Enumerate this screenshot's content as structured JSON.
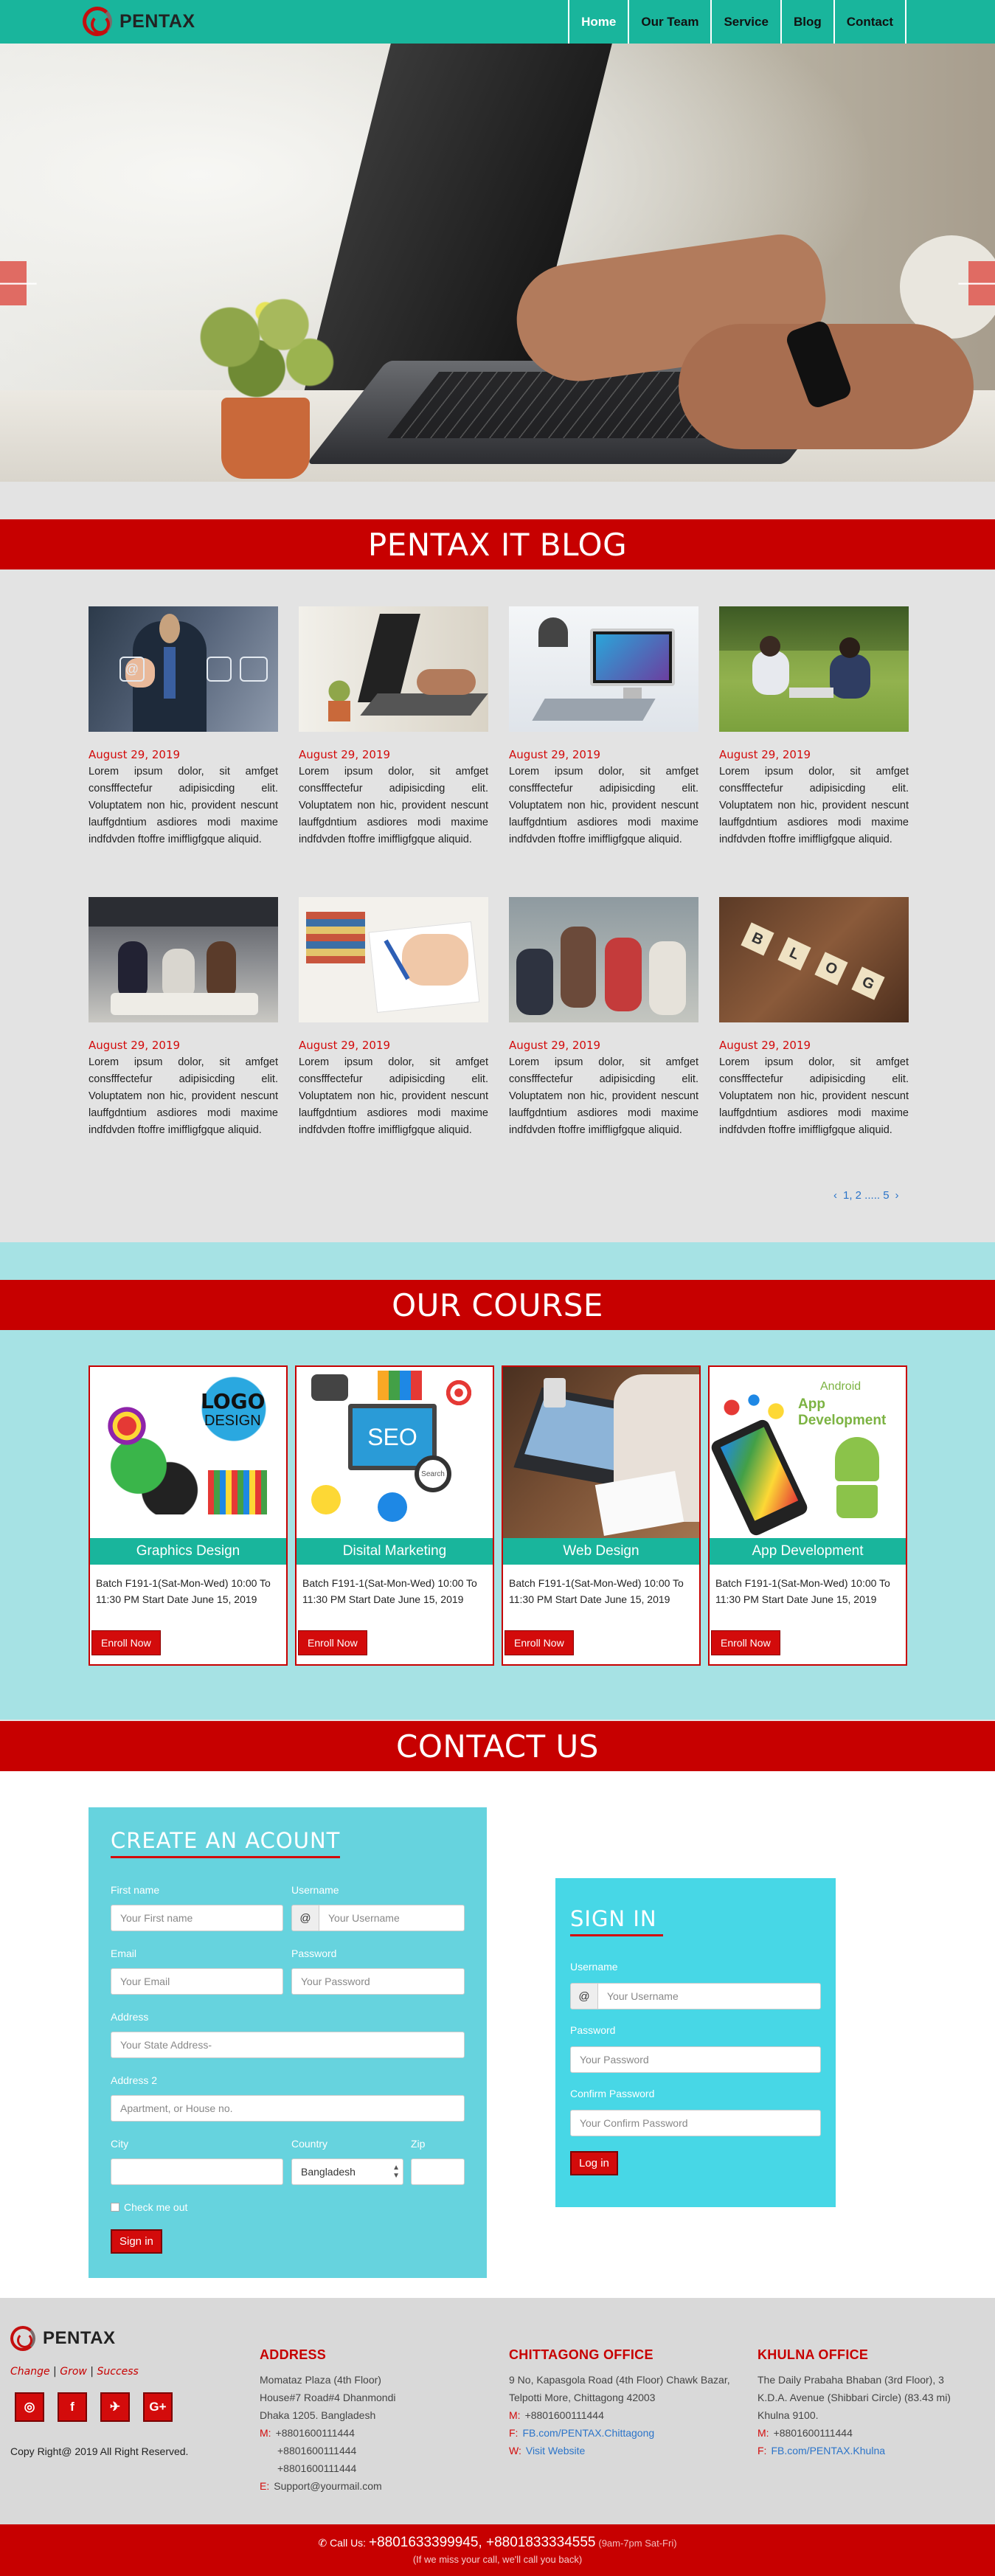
{
  "brand": {
    "name": "PENTAX"
  },
  "nav": {
    "items": [
      "Home",
      "Our Team",
      "Service",
      "Blog",
      "Contact"
    ]
  },
  "hero": {
    "prev_icon": "arrow-left-icon",
    "next_icon": "arrow-right-icon",
    "left_arrow": "🡐",
    "right_arrow": "🡒",
    "slides": 6,
    "active_slide": 2
  },
  "blog": {
    "heading": "PENTAX IT BLOG",
    "posts": [
      {
        "date": "August 29, 2019",
        "text": "Lorem ipsum dolor, sit amfget consfffectefur adipisicding elit. Voluptatem non hic, provident nescunt lauffgdntium asdiores modi maxime indfdvden ftoffre imiffligfgque aliquid."
      },
      {
        "date": "August 29, 2019",
        "text": "Lorem ipsum dolor, sit amfget consfffectefur adipisicding elit. Voluptatem non hic, provident nescunt lauffgdntium asdiores modi maxime indfdvden ftoffre imiffligfgque aliquid."
      },
      {
        "date": "August 29, 2019",
        "text": "Lorem ipsum dolor, sit amfget consfffectefur adipisicding elit. Voluptatem non hic, provident nescunt lauffgdntium asdiores modi maxime indfdvden ftoffre imiffligfgque aliquid."
      },
      {
        "date": "August 29, 2019",
        "text": "Lorem ipsum dolor, sit amfget consfffectefur adipisicding elit. Voluptatem non hic, provident nescunt lauffgdntium asdiores modi maxime indfdvden ftoffre imiffligfgque aliquid."
      },
      {
        "date": "August 29, 2019",
        "text": "Lorem ipsum dolor, sit amfget consfffectefur adipisicding elit. Voluptatem non hic, provident nescunt lauffgdntium asdiores modi maxime indfdvden ftoffre imiffligfgque aliquid."
      },
      {
        "date": "August 29, 2019",
        "text": "Lorem ipsum dolor, sit amfget consfffectefur adipisicding elit. Voluptatem non hic, provident nescunt lauffgdntium asdiores modi maxime indfdvden ftoffre imiffligfgque aliquid."
      },
      {
        "date": "August 29, 2019",
        "text": "Lorem ipsum dolor, sit amfget consfffectefur adipisicding elit. Voluptatem non hic, provident nescunt lauffgdntium asdiores modi maxime indfdvden ftoffre imiffligfgque aliquid."
      },
      {
        "date": "August 29, 2019",
        "text": "Lorem ipsum dolor, sit amfget consfffectefur adipisicding elit. Voluptatem non hic, provident nescunt lauffgdntium asdiores modi maxime indfdvden ftoffre imiffligfgque aliquid."
      }
    ],
    "pager": {
      "prev": "‹",
      "pages": "1, 2 ..... 5",
      "next": "›"
    }
  },
  "courses": {
    "heading": "OUR COURSE",
    "items": [
      {
        "title": "Graphics Design",
        "desc": "Batch F191-1(Sat-Mon-Wed) 10:00 To 11:30 PM Start Date June 15, 2019",
        "button": "Enroll Now",
        "img_text_1": "LOGO",
        "img_text_2": "DESIGN"
      },
      {
        "title": "Disital Marketing",
        "desc": "Batch F191-1(Sat-Mon-Wed) 10:00 To 11:30 PM Start Date June 15, 2019",
        "button": "Enroll Now",
        "img_text_1": "SEO",
        "img_text_2": "Search"
      },
      {
        "title": "Web Design",
        "desc": "Batch F191-1(Sat-Mon-Wed) 10:00 To 11:30 PM Start Date June 15, 2019",
        "button": "Enroll Now"
      },
      {
        "title": "App Development",
        "desc": "Batch F191-1(Sat-Mon-Wed) 10:00 To 11:30 PM Start Date June 15, 2019",
        "button": "Enroll Now",
        "img_text_1": "Android",
        "img_text_2": "App Development"
      }
    ]
  },
  "contact": {
    "heading": "CONTACT US",
    "create": {
      "title": "CREATE AN ACOUNT",
      "first_name_label": "First name",
      "first_name_ph": "Your First name",
      "username_label": "Username",
      "username_ph": "Your Username",
      "at": "@",
      "email_label": "Email",
      "email_ph": "Your Email",
      "password_label": "Password",
      "password_ph": "Your Password",
      "address_label": "Address",
      "address_ph": "Your State Address-",
      "address2_label": "Address 2",
      "address2_ph": "Apartment, or House no.",
      "city_label": "City",
      "country_label": "Country",
      "country_value": "Bangladesh",
      "zip_label": "Zip",
      "check_label": "Check me out",
      "submit": "Sign in"
    },
    "signin": {
      "title": "SIGN IN",
      "username_label": "Username",
      "username_ph": "Your Username",
      "at": "@",
      "password_label": "Password",
      "password_ph": "Your Password",
      "confirm_label": "Confirm Password",
      "confirm_ph": "Your Confirm Password",
      "submit": "Log in"
    }
  },
  "footer": {
    "brand": "PENTAX",
    "tagline": {
      "a": "Change",
      "sep": " | ",
      "b": "Grow",
      "c": "Success"
    },
    "social": [
      "◎",
      "f",
      "✈",
      "G+"
    ],
    "copyright": "Copy Right@ 2019 All Right Reserved.",
    "offices": [
      {
        "title": "ADDRESS",
        "lines": [
          "Momataz Plaza (4th Floor)",
          "House#7 Road#4 Dhanmondi",
          "Dhaka 1205. Bangladesh"
        ],
        "m_label": "M:",
        "phones": [
          "+8801600111444",
          "+8801600111444",
          "+8801600111444"
        ],
        "e_label": "E:",
        "email": "Support@yourmail.com"
      },
      {
        "title": "CHITTAGONG OFFICE",
        "lines": [
          "9 No, Kapasgola Road (4th Floor) Chawk Bazar, Telpotti More, Chittagong 42003"
        ],
        "m_label": "M:",
        "phone": "+8801600111444",
        "f_label": "F:",
        "fb": "FB.com/PENTAX.Chittagong",
        "w_label": "W:",
        "web": "Visit Website"
      },
      {
        "title": "KHULNA OFFICE",
        "lines": [
          "The Daily Prabaha Bhaban (3rd Floor), 3 K.D.A. Avenue (Shibbari Circle) (83.43 mi) Khulna 9100."
        ],
        "m_label": "M:",
        "phone": "+8801600111444",
        "f_label": "F:",
        "fb": "FB.com/PENTAX.Khulna"
      }
    ],
    "call": {
      "prefix": "Call Us:",
      "numbers": "+8801633399945, +8801833334555",
      "hours": "(9am-7pm Sat-Fri)",
      "note": "(If we miss your call, we'll call you back)"
    }
  },
  "colors": {
    "teal": "#19b59c",
    "red": "#c70000",
    "aqua": "#a6e2e4",
    "form": "#66d3de"
  }
}
